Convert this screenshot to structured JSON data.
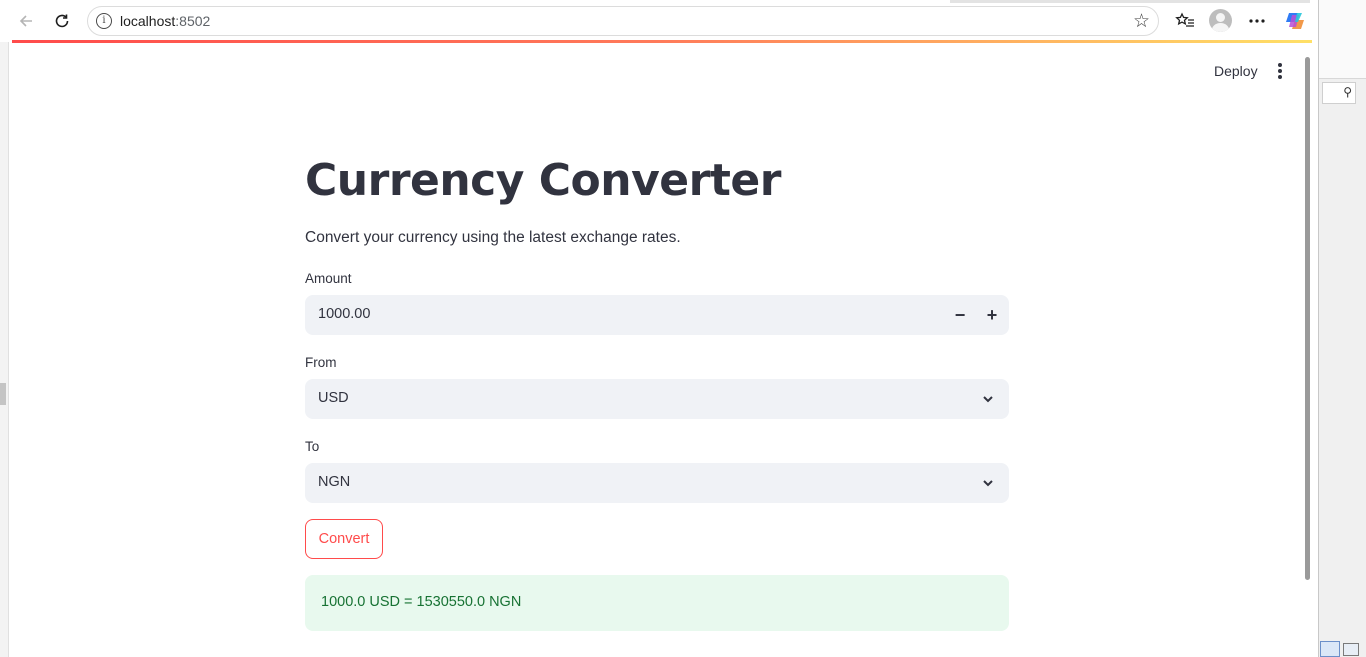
{
  "browser": {
    "url_host": "localhost",
    "url_port": ":8502"
  },
  "app": {
    "deploy_label": "Deploy",
    "title": "Currency Converter",
    "subtitle": "Convert your currency using the latest exchange rates.",
    "amount": {
      "label": "Amount",
      "value": "1000.00",
      "decrement": "−",
      "increment": "+"
    },
    "from": {
      "label": "From",
      "value": "USD"
    },
    "to": {
      "label": "To",
      "value": "NGN"
    },
    "convert_label": "Convert",
    "result": "1000.0 USD = 1530550.0 NGN"
  },
  "colors": {
    "accent": "#ff4b4b",
    "success_bg": "#e8f9ee",
    "success_text": "#177233",
    "input_bg": "#f0f2f6"
  }
}
